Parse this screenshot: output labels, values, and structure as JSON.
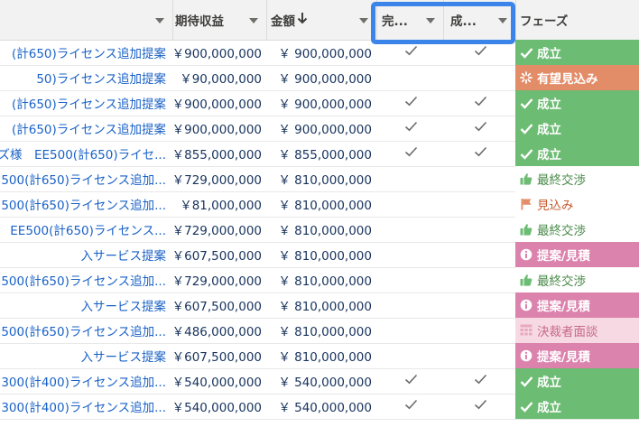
{
  "columns": {
    "expected_revenue": "期待収益",
    "amount": "金額",
    "closed_flag": "完...",
    "won_flag": "成...",
    "phase": "フェーズ",
    "amount_sort_icon": "arrow-down-icon"
  },
  "colors": {
    "won": "#6cbc73",
    "probable": "#e38c68",
    "proposal": "#db82ad",
    "decision": "#f7d9e3",
    "link": "#1a62c7",
    "highlight": "#3b84ea"
  },
  "rows": [
    {
      "name": "(計650)ライセンス追加提案",
      "expected": "￥900,000,000",
      "amount": "￥ 900,000,000",
      "closed": true,
      "won": true,
      "phase": "成立",
      "phase_type": "won",
      "phase_icon": "check-icon"
    },
    {
      "name": "50)ライセンス追加提案",
      "expected": "￥90,000,000",
      "amount": "￥ 900,000,000",
      "closed": false,
      "won": false,
      "phase": "有望見込み",
      "phase_type": "probable",
      "phase_icon": "sparkle-icon"
    },
    {
      "name": "(計650)ライセンス追加提案",
      "expected": "￥900,000,000",
      "amount": "￥ 900,000,000",
      "closed": true,
      "won": true,
      "phase": "成立",
      "phase_type": "won",
      "phase_icon": "check-icon"
    },
    {
      "name": "(計650)ライセンス追加提案",
      "expected": "￥900,000,000",
      "amount": "￥ 900,000,000",
      "closed": true,
      "won": true,
      "phase": "成立",
      "phase_type": "won",
      "phase_icon": "check-icon"
    },
    {
      "name": "ズ様　EE500(計650)ライセ...",
      "expected": "￥855,000,000",
      "amount": "￥ 855,000,000",
      "closed": true,
      "won": true,
      "phase": "成立",
      "phase_type": "won",
      "phase_icon": "check-icon"
    },
    {
      "name": "500(計650)ライセンス追加...",
      "expected": "￥729,000,000",
      "amount": "￥ 810,000,000",
      "closed": false,
      "won": false,
      "phase": "最終交渉",
      "phase_type": "final",
      "phase_icon": "thumbs-up-icon"
    },
    {
      "name": "500(計650)ライセンス追加...",
      "expected": "￥81,000,000",
      "amount": "￥ 810,000,000",
      "closed": false,
      "won": false,
      "phase": "見込み",
      "phase_type": "mikomi",
      "phase_icon": "flag-icon"
    },
    {
      "name": "EE500(計650)ライセンス...",
      "expected": "￥729,000,000",
      "amount": "￥ 810,000,000",
      "closed": false,
      "won": false,
      "phase": "最終交渉",
      "phase_type": "final",
      "phase_icon": "thumbs-up-icon"
    },
    {
      "name": "入サービス提案",
      "expected": "￥607,500,000",
      "amount": "￥ 810,000,000",
      "closed": false,
      "won": false,
      "phase": "提案/見積",
      "phase_type": "proposal",
      "phase_icon": "info-icon"
    },
    {
      "name": "500(計650)ライセンス追加...",
      "expected": "￥729,000,000",
      "amount": "￥ 810,000,000",
      "closed": false,
      "won": false,
      "phase": "最終交渉",
      "phase_type": "final",
      "phase_icon": "thumbs-up-icon"
    },
    {
      "name": "入サービス提案",
      "expected": "￥607,500,000",
      "amount": "￥ 810,000,000",
      "closed": false,
      "won": false,
      "phase": "提案/見積",
      "phase_type": "proposal",
      "phase_icon": "info-icon"
    },
    {
      "name": "500(計650)ライセンス追加...",
      "expected": "￥486,000,000",
      "amount": "￥ 810,000,000",
      "closed": false,
      "won": false,
      "phase": "決裁者面談",
      "phase_type": "decision",
      "phase_icon": "grid-icon"
    },
    {
      "name": "入サービス提案",
      "expected": "￥607,500,000",
      "amount": "￥ 810,000,000",
      "closed": false,
      "won": false,
      "phase": "提案/見積",
      "phase_type": "proposal",
      "phase_icon": "info-icon"
    },
    {
      "name": "300(計400)ライセンス追加...",
      "expected": "￥540,000,000",
      "amount": "￥ 540,000,000",
      "closed": true,
      "won": true,
      "phase": "成立",
      "phase_type": "won",
      "phase_icon": "check-icon"
    },
    {
      "name": "300(計400)ライセンス追加...",
      "expected": "￥540,000,000",
      "amount": "￥ 540,000,000",
      "closed": true,
      "won": true,
      "phase": "成立",
      "phase_type": "won",
      "phase_icon": "check-icon"
    }
  ]
}
